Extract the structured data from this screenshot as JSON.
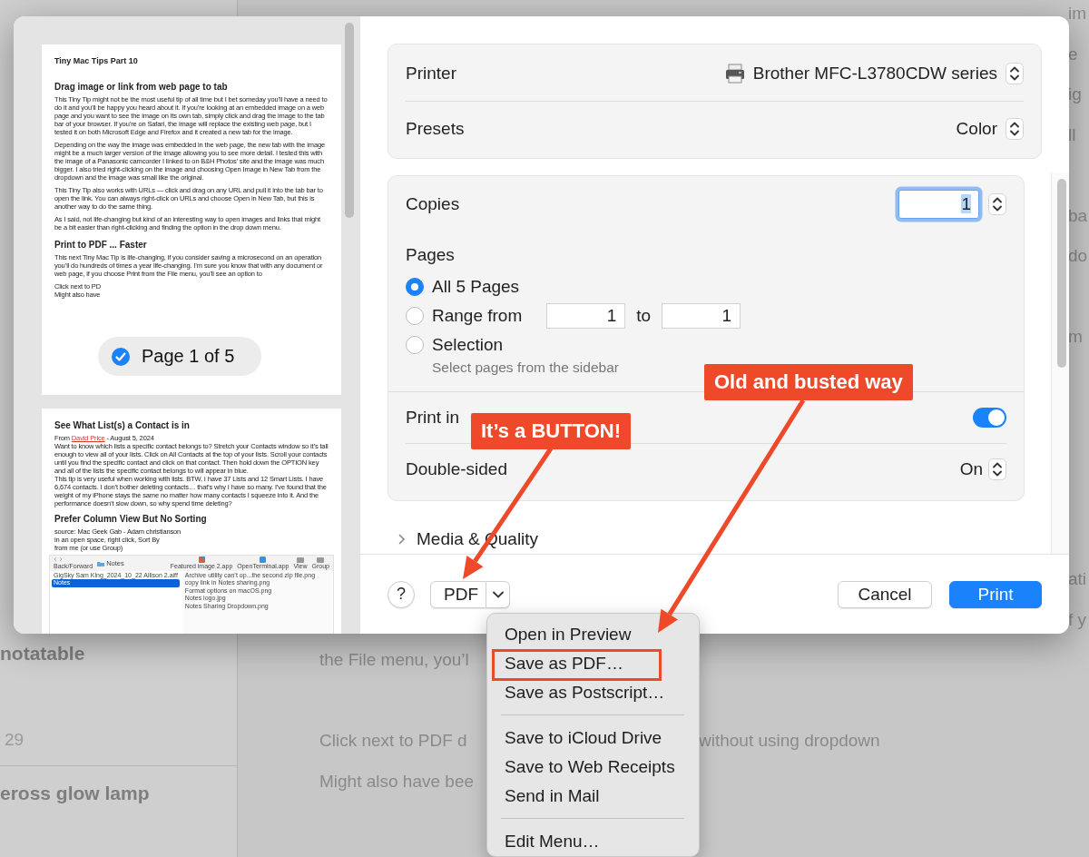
{
  "background": {
    "sidebar_items": [
      {
        "title": "notatable",
        "date": "29"
      },
      {
        "title": "eross glow lamp"
      }
    ],
    "note_lines": [
      {
        "edge": "im"
      },
      {
        "edge": "e"
      },
      {
        "edge": "ig"
      },
      {
        "edge": "ll"
      },
      {
        "edge": "ba"
      },
      {
        "edge": "do"
      },
      {
        "edge": "m"
      },
      {
        "edge": "ati"
      },
      {
        "edge": "f y"
      },
      {
        "left": "the File menu, you’l"
      },
      {
        "left": "Click next to PDF d",
        "right": "without using dropdown"
      },
      {
        "left": "Might also have bee"
      }
    ]
  },
  "dialog": {
    "preview": {
      "pages": [
        {
          "blocks": [
            {
              "kind": "title",
              "text": "Tiny Mac Tips Part 10"
            },
            {
              "kind": "heading",
              "text": "Drag image or link from web page to tab"
            },
            {
              "kind": "para",
              "text": "This Tiny Tip might not be the most useful tip of all time but I bet someday you’ll have a need to do it and you’ll be happy you heard about it. If you’re looking at an embedded image on a web page and you want to see the image on its own tab, simply click and drag the image to the tab bar of your browser. If you’re on Safari, the image will replace the existing web page, but I tested it on both Microsoft Edge and Firefox and it created a new tab for the image."
            },
            {
              "kind": "para",
              "text": "Depending on the way the image was embedded in the web page, the new tab with the image might be a much larger version of the image allowing you to see more detail. I tested this with the image of a Panasonic camcorder I linked to on B&H Photos’ site and the image was much bigger. I also tried right-clicking on the image and choosing Open Image in New Tab from the dropdown and the image was small like the original."
            },
            {
              "kind": "para",
              "text": "This Tiny Tip also works with URLs — click and drag on any URL and pull it into the tab bar to open the link. You can always right-click on URLs and choose Open in New Tab, but this is another way to do the same thing."
            },
            {
              "kind": "para",
              "text": "As I said, not life-changing but kind of an interesting way to open images and links that might be a bit easier than right-clicking and finding the option in the drop down menu."
            },
            {
              "kind": "heading",
              "text": "Print to PDF ... Faster"
            },
            {
              "kind": "para",
              "text": "This next Tiny Mac Tip is life-changing, if you consider saving a microsecond on an operation you’ll do hundreds of times a year life-changing.  I’m sure you know that with any document or web page, if you choose Print from the File menu, you’ll see an option to"
            },
            {
              "kind": "line",
              "text": "Click next to PD"
            },
            {
              "kind": "line",
              "text": "Might also have"
            }
          ]
        },
        {
          "blocks": [
            {
              "kind": "heading",
              "text": "See What List(s) a Contact is in"
            },
            {
              "kind": "byline",
              "prefix": "From ",
              "link": "David Price",
              "suffix": " - August 5, 2024"
            },
            {
              "kind": "line",
              "text": "Want to know which lists a specific contact belongs to? Stretch your Contacts window so it’s tall enough to view all of your lists. Click on All Contacts at the top of your lists. Scroll your contacts until you find the specific contact and click on that contact. Then hold down the OPTION key and all of the lists the specific contact belongs to will appear in blue."
            },
            {
              "kind": "line",
              "text": "This tip is very useful when working with lists. BTW, I have 37 Lists and 12 Smart Lists. I have 6,674 contacts. I don’t bother deleting contacts… that’s why I have so many. I’ve found that the weight of my iPhone stays the same no matter how many contacts I squeeze into it. And the performance doesn’t slow down, so why spend time deleting?"
            },
            {
              "kind": "heading",
              "text": "Prefer Column View But No Sorting"
            },
            {
              "kind": "line",
              "text": "source: Mac Geek Gab - Adam christianson"
            },
            {
              "kind": "line",
              "text": "in an open space, right click, Sort By"
            },
            {
              "kind": "line",
              "text": "from me (or use Group)"
            },
            {
              "kind": "finder",
              "nav_label": "Back/Forward",
              "folder": "Notes",
              "apps": [
                "Featured image 2.app",
                "OpenTerminal.app"
              ],
              "tools": [
                "View",
                "Group"
              ],
              "left_items": [
                {
                  "label": "GigSky Sam King_2024_10_22 Allison 2.aiff",
                  "selected": false
                },
                {
                  "label": "Notes",
                  "selected": true
                }
              ],
              "right_items": [
                "Archive utility can’t op...the second zip file.png",
                "copy link in Notes sharing.png",
                "Format options on macOS.png",
                "Notes logo.jpg",
                "Notes Sharing Dropdown.png"
              ]
            }
          ]
        }
      ],
      "page_badge": {
        "label": "Page 1 of 5",
        "checked": true
      }
    },
    "printer": {
      "label": "Printer",
      "value": "Brother MFC-L3780CDW series"
    },
    "presets": {
      "label": "Presets",
      "value": "Color"
    },
    "copies": {
      "label": "Copies",
      "value": "1",
      "focused": true
    },
    "pages": {
      "label": "Pages",
      "options": [
        {
          "kind": "all",
          "label": "All 5 Pages",
          "selected": true
        },
        {
          "kind": "range",
          "label": "Range from",
          "from": "1",
          "to_label": "to",
          "to": "1",
          "selected": false
        },
        {
          "kind": "selection",
          "label": "Selection",
          "hint": "Select pages from the sidebar",
          "selected": false
        }
      ]
    },
    "print_in_color": {
      "label": "Print in",
      "on": true
    },
    "double_sided": {
      "label": "Double-sided",
      "value": "On"
    },
    "media_quality": {
      "label": "Media & Quality",
      "expanded": false
    },
    "buttons": {
      "help": "?",
      "pdf": "PDF",
      "cancel": "Cancel",
      "print": "Print"
    }
  },
  "pdf_menu": {
    "groups": [
      [
        {
          "label": "Open in Preview",
          "boxed": false
        },
        {
          "label": "Save as PDF…",
          "boxed": true
        },
        {
          "label": "Save as Postscript…",
          "boxed": false
        }
      ],
      [
        {
          "label": "Save to iCloud Drive",
          "boxed": false
        },
        {
          "label": "Save to Web Receipts",
          "boxed": false
        },
        {
          "label": "Send in Mail",
          "boxed": false
        }
      ],
      [
        {
          "label": "Edit Menu…",
          "boxed": false
        }
      ]
    ]
  },
  "annotations": [
    {
      "text": "Old and busted way"
    },
    {
      "text": "It’s a BUTTON!"
    }
  ]
}
